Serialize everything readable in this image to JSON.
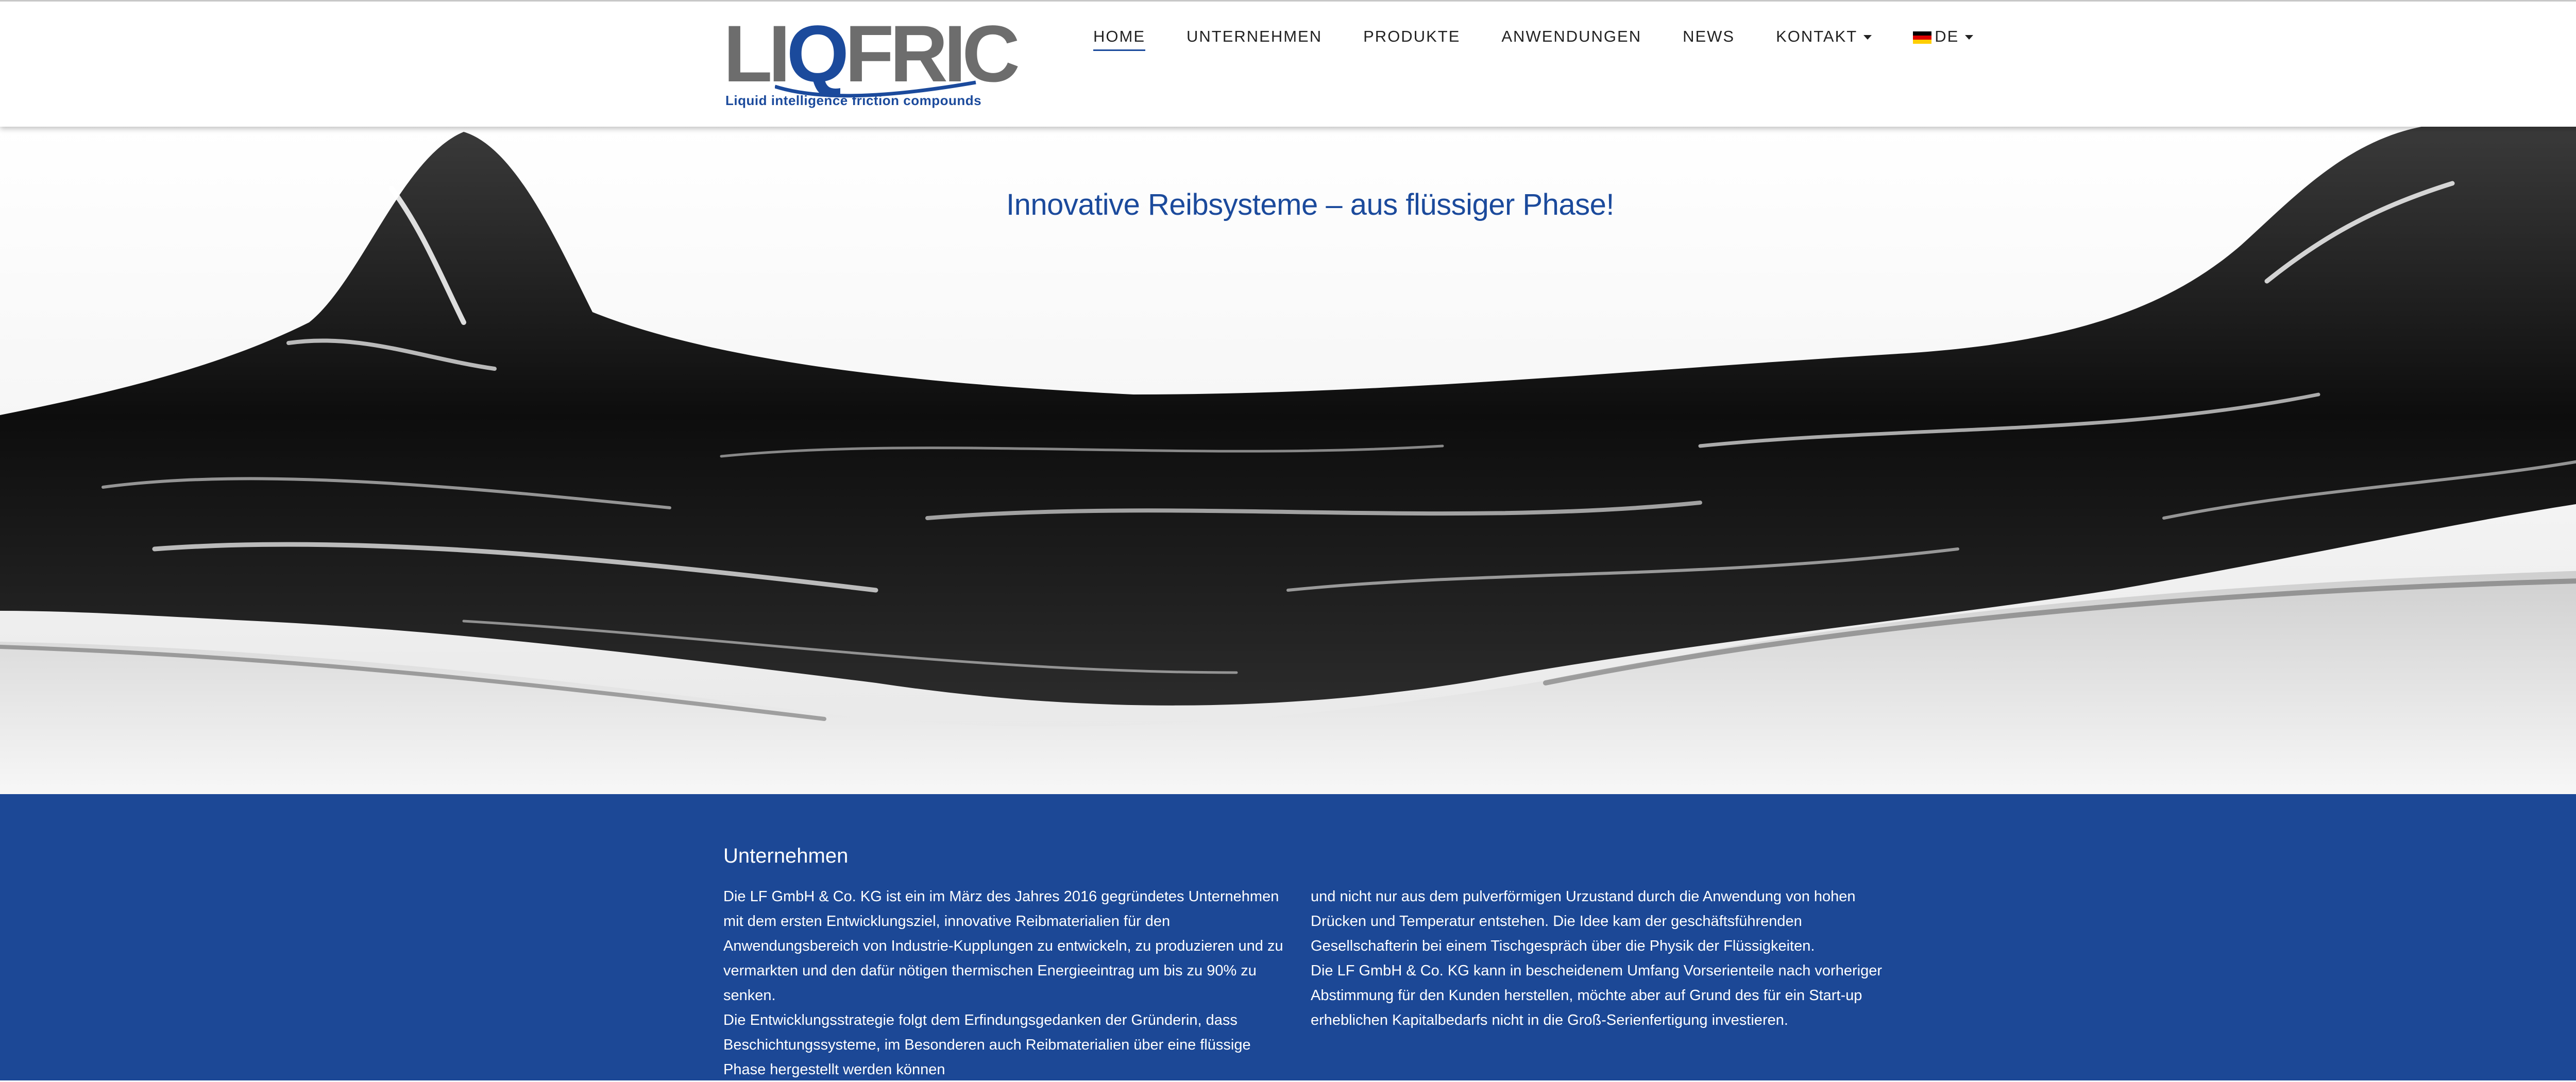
{
  "header": {
    "logo": {
      "wordmark": "LIQFRIC",
      "tagline": "Liquid intelligence friction compounds",
      "brand_gray": "#6d6d6d",
      "brand_blue": "#1b4a9c"
    },
    "nav": [
      {
        "label": "HOME",
        "active": true
      },
      {
        "label": "UNTERNEHMEN"
      },
      {
        "label": "PRODUKTE"
      },
      {
        "label": "ANWENDUNGEN"
      },
      {
        "label": "NEWS"
      },
      {
        "label": "KONTAKT",
        "dropdown": true
      },
      {
        "label": "DE",
        "dropdown": true,
        "icon": "german-flag-icon"
      }
    ]
  },
  "hero": {
    "headline": "Innovative Reibsysteme – aus flüssiger Phase!",
    "headline_color": "#1b4a9c"
  },
  "company": {
    "background": "#1c4896",
    "heading": "Unternehmen",
    "left_paragraphs": [
      "Die LF GmbH & Co. KG ist ein im März des Jahres 2016 gegründetes Unternehmen mit dem ersten Entwicklungsziel, innovative Reibmaterialien für den Anwendungsbereich von Industrie-Kupplungen zu entwickeln, zu produzieren und zu vermarkten und den dafür nötigen thermischen Energieeintrag um bis zu 90% zu senken.",
      "Die Entwicklungsstrategie folgt dem Erfindungsgedanken der Gründerin, dass Beschichtungssysteme, im Besonderen auch Reibmaterialien über eine flüssige Phase hergestellt werden können"
    ],
    "right_paragraphs": [
      "und nicht nur aus dem pulverförmigen Urzustand durch die Anwendung von hohen Drücken und Temperatur entstehen. Die Idee kam der geschäftsführenden Gesellschafterin bei einem Tischgespräch über die Physik der Flüssigkeiten.",
      "Die LF GmbH & Co. KG kann in bescheidenem Umfang Vorserienteile nach vorheriger Abstimmung für den Kunden herstellen, möchte aber auf Grund des für ein Start-up erheblichen Kapitalbedarfs nicht in die Groß-Serienfertigung investieren."
    ]
  }
}
